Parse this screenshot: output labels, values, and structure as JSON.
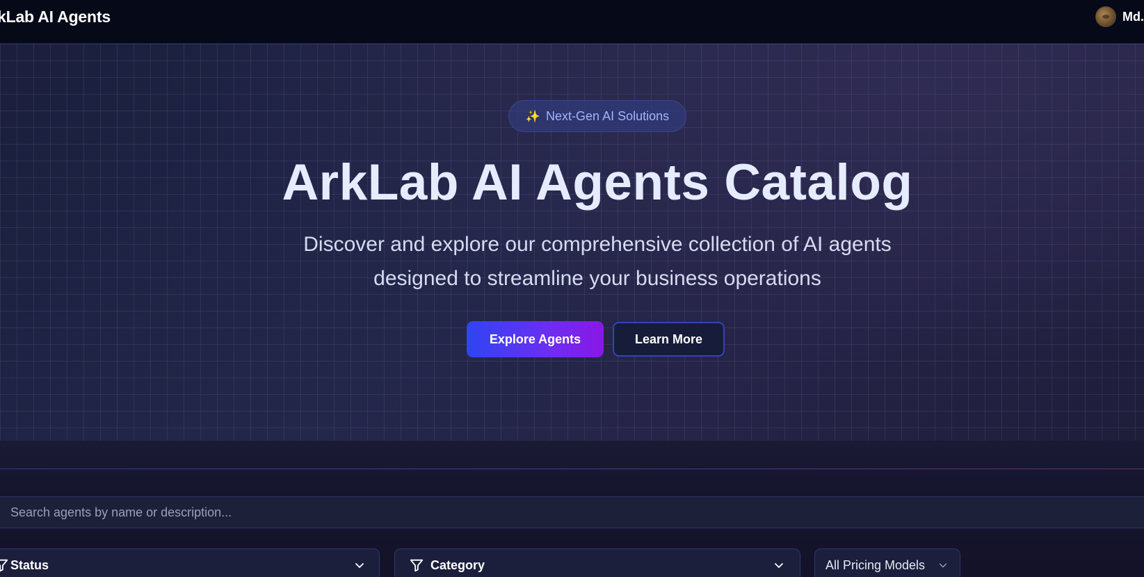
{
  "header": {
    "brand": "kLab AI Agents",
    "user_name": "Md."
  },
  "hero": {
    "badge_icon": "✨",
    "badge_text": "Next-Gen AI Solutions",
    "title": "ArkLab AI Agents Catalog",
    "subtitle_line1": "Discover and explore our comprehensive collection of AI agents",
    "subtitle_line2": "designed to streamline your business operations",
    "primary_button": "Explore Agents",
    "secondary_button": "Learn More"
  },
  "search": {
    "placeholder": "Search agents by name or description..."
  },
  "filters": {
    "status_label": "Status",
    "category_label": "Category",
    "pricing_label": "All Pricing Models"
  },
  "colors": {
    "accent_blue": "#2f45f2",
    "accent_purple": "#8a17e6",
    "badge_text": "#9fb4ff"
  }
}
